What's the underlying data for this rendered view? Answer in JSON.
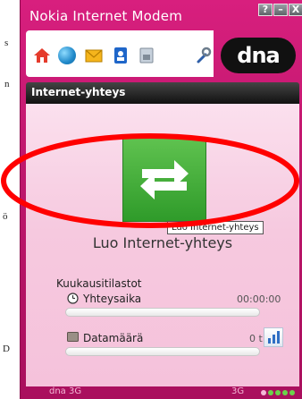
{
  "background": {
    "fragments": [
      "s",
      "n",
      "ö",
      "D"
    ]
  },
  "window": {
    "title": "Nokia Internet Modem",
    "buttons": {
      "help": "?",
      "minimize": "–",
      "close": "X"
    }
  },
  "toolbar": {
    "icons": [
      "home-icon",
      "globe-icon",
      "mail-icon",
      "contacts-icon",
      "sim-icon",
      "settings-icon"
    ],
    "logo_text": "dna"
  },
  "panel": {
    "header": "Internet-yhteys",
    "connect_tooltip": "Luo Internet-yhteys",
    "connect_label": "Luo Internet-yhteys"
  },
  "stats": {
    "title": "Kuukausitilastot",
    "connection_time": {
      "label": "Yhteysaika",
      "value": "00:00:00",
      "progress": 0
    },
    "data_amount": {
      "label": "Datamäärä",
      "value": "0 t",
      "progress": 0
    }
  },
  "status": {
    "operator": "dna 3G",
    "network": "3G",
    "signal_bars": 4
  },
  "colors": {
    "brand_pink": "#d81f7e",
    "connect_green": "#3fa936",
    "annotation_red": "#ff0000"
  }
}
